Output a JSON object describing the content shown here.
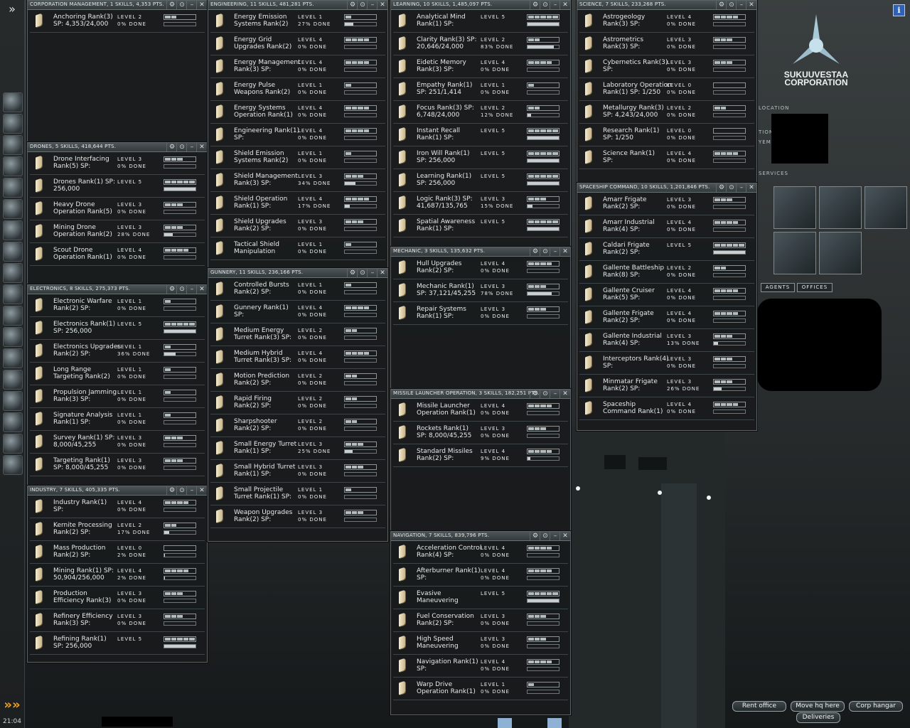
{
  "clock": "21:04",
  "neocom": {
    "expand_glyph": "»",
    "bottom_glyph": "»»",
    "icons": [
      "character-sheet-icon",
      "people-icon",
      "mail-icon",
      "notepad-icon",
      "map-icon",
      "network-icon",
      "assets-icon",
      "corporation-icon",
      "skills-icon",
      "wallet-icon",
      "help-icon",
      "channels-icon",
      "market-icon",
      "journal-icon",
      "audio-icon",
      "info-icon",
      "fitting-icon",
      "ship-icon"
    ]
  },
  "windows": [
    {
      "title": "CORPORATION MANAGEMENT, 1 SKILLS, 4,353 PTS.",
      "skills": [
        {
          "name": "Anchoring Rank(3)",
          "sp": "SP: 4,353/24,000",
          "level": "LEVEL 2",
          "done": "0% DONE",
          "lvl": 2,
          "pct": 0
        }
      ]
    },
    {
      "title": "DRONES, 5 SKILLS, 418,644 PTS.",
      "skills": [
        {
          "name": "Drone Interfacing",
          "sp": "Rank(5) SP:",
          "level": "LEVEL 3",
          "done": "0% DONE",
          "lvl": 3,
          "pct": 0
        },
        {
          "name": "Drones Rank(1) SP:",
          "sp": "256,000",
          "level": "LEVEL 5",
          "done": "",
          "lvl": 5,
          "pct": 100
        },
        {
          "name": "Heavy Drone",
          "sp": "Operation Rank(5)",
          "level": "LEVEL 3",
          "done": "0% DONE",
          "lvl": 3,
          "pct": 0
        },
        {
          "name": "Mining Drone",
          "sp": "Operation Rank(2)",
          "level": "LEVEL 3",
          "done": "28% DONE",
          "lvl": 3,
          "pct": 28
        },
        {
          "name": "Scout Drone",
          "sp": "Operation Rank(1)",
          "level": "LEVEL 4",
          "done": "0% DONE",
          "lvl": 4,
          "pct": 0
        }
      ]
    },
    {
      "title": "ELECTRONICS, 8 SKILLS, 275,373 PTS.",
      "skills": [
        {
          "name": "Electronic Warfare",
          "sp": "Rank(2) SP:",
          "level": "LEVEL 1",
          "done": "0% DONE",
          "lvl": 1,
          "pct": 0
        },
        {
          "name": "Electronics Rank(1)",
          "sp": "SP: 256,000",
          "level": "LEVEL 5",
          "done": "",
          "lvl": 5,
          "pct": 100
        },
        {
          "name": "Electronics Upgrades",
          "sp": "Rank(2) SP:",
          "level": "LEVEL 1",
          "done": "36% DONE",
          "lvl": 1,
          "pct": 36
        },
        {
          "name": "Long Range",
          "sp": "Targeting Rank(2)",
          "level": "LEVEL 1",
          "done": "0% DONE",
          "lvl": 1,
          "pct": 0
        },
        {
          "name": "Propulsion Jamming",
          "sp": "Rank(3) SP:",
          "level": "LEVEL 1",
          "done": "0% DONE",
          "lvl": 1,
          "pct": 0
        },
        {
          "name": "Signature Analysis",
          "sp": "Rank(1) SP:",
          "level": "LEVEL 1",
          "done": "0% DONE",
          "lvl": 1,
          "pct": 0
        },
        {
          "name": "Survey Rank(1) SP:",
          "sp": "8,000/45,255",
          "level": "LEVEL 3",
          "done": "0% DONE",
          "lvl": 3,
          "pct": 0
        },
        {
          "name": "Targeting Rank(1)",
          "sp": "SP: 8,000/45,255",
          "level": "LEVEL 3",
          "done": "0% DONE",
          "lvl": 3,
          "pct": 0
        }
      ]
    },
    {
      "title": "INDUSTRY, 7 SKILLS, 405,335 PTS.",
      "skills": [
        {
          "name": "Industry Rank(1)",
          "sp": "SP:",
          "level": "LEVEL 4",
          "done": "0% DONE",
          "lvl": 4,
          "pct": 0
        },
        {
          "name": "Kernite Processing",
          "sp": "Rank(2) SP:",
          "level": "LEVEL 2",
          "done": "17% DONE",
          "lvl": 2,
          "pct": 17
        },
        {
          "name": "Mass Production",
          "sp": "Rank(2) SP:",
          "level": "LEVEL 0",
          "done": "2% DONE",
          "lvl": 0,
          "pct": 2
        },
        {
          "name": "Mining Rank(1) SP:",
          "sp": "50,904/256,000",
          "level": "LEVEL 4",
          "done": "2% DONE",
          "lvl": 4,
          "pct": 2
        },
        {
          "name": "Production",
          "sp": "Efficiency Rank(3)",
          "level": "LEVEL 3",
          "done": "0% DONE",
          "lvl": 3,
          "pct": 0
        },
        {
          "name": "Refinery Efficiency",
          "sp": "Rank(3) SP:",
          "level": "LEVEL 3",
          "done": "0% DONE",
          "lvl": 3,
          "pct": 0
        },
        {
          "name": "Refining Rank(1)",
          "sp": "SP: 256,000",
          "level": "LEVEL 5",
          "done": "",
          "lvl": 5,
          "pct": 100
        }
      ]
    },
    {
      "title": "ENGINEERING, 11 SKILLS, 481,281 PTS.",
      "skills": [
        {
          "name": "Energy Emission",
          "sp": "Systems Rank(2)",
          "level": "LEVEL 1",
          "done": "27% DONE",
          "lvl": 1,
          "pct": 27
        },
        {
          "name": "Energy Grid",
          "sp": "Upgrades Rank(2)",
          "level": "LEVEL 4",
          "done": "0% DONE",
          "lvl": 4,
          "pct": 0
        },
        {
          "name": "Energy Management",
          "sp": "Rank(3) SP:",
          "level": "LEVEL 4",
          "done": "0% DONE",
          "lvl": 4,
          "pct": 0
        },
        {
          "name": "Energy Pulse",
          "sp": "Weapons Rank(2)",
          "level": "LEVEL 1",
          "done": "0% DONE",
          "lvl": 1,
          "pct": 0
        },
        {
          "name": "Energy Systems",
          "sp": "Operation Rank(1)",
          "level": "LEVEL 4",
          "done": "0% DONE",
          "lvl": 4,
          "pct": 0
        },
        {
          "name": "Engineering Rank(1)",
          "sp": "SP:",
          "level": "LEVEL 4",
          "done": "0% DONE",
          "lvl": 4,
          "pct": 0
        },
        {
          "name": "Shield Emission",
          "sp": "Systems Rank(2)",
          "level": "LEVEL 1",
          "done": "0% DONE",
          "lvl": 1,
          "pct": 0
        },
        {
          "name": "Shield Management",
          "sp": "Rank(3) SP:",
          "level": "LEVEL 3",
          "done": "34% DONE",
          "lvl": 3,
          "pct": 34
        },
        {
          "name": "Shield Operation",
          "sp": "Rank(1) SP:",
          "level": "LEVEL 4",
          "done": "17% DONE",
          "lvl": 4,
          "pct": 17
        },
        {
          "name": "Shield Upgrades",
          "sp": "Rank(2) SP:",
          "level": "LEVEL 3",
          "done": "0% DONE",
          "lvl": 3,
          "pct": 0
        },
        {
          "name": "Tactical Shield",
          "sp": "Manipulation",
          "level": "LEVEL 1",
          "done": "0% DONE",
          "lvl": 1,
          "pct": 0
        }
      ]
    },
    {
      "title": "GUNNERY, 11 SKILLS, 236,166 PTS.",
      "skills": [
        {
          "name": "Controlled Bursts",
          "sp": "Rank(2) SP:",
          "level": "LEVEL 1",
          "done": "0% DONE",
          "lvl": 1,
          "pct": 0
        },
        {
          "name": "Gunnery Rank(1)",
          "sp": "SP:",
          "level": "LEVEL 4",
          "done": "0% DONE",
          "lvl": 4,
          "pct": 0
        },
        {
          "name": "Medium Energy",
          "sp": "Turret Rank(3) SP:",
          "level": "LEVEL 2",
          "done": "0% DONE",
          "lvl": 2,
          "pct": 0
        },
        {
          "name": "Medium Hybrid",
          "sp": "Turret Rank(3) SP:",
          "level": "LEVEL 4",
          "done": "0% DONE",
          "lvl": 4,
          "pct": 0
        },
        {
          "name": "Motion Prediction",
          "sp": "Rank(2) SP:",
          "level": "LEVEL 2",
          "done": "0% DONE",
          "lvl": 2,
          "pct": 0
        },
        {
          "name": "Rapid Firing",
          "sp": "Rank(2) SP:",
          "level": "LEVEL 2",
          "done": "0% DONE",
          "lvl": 2,
          "pct": 0
        },
        {
          "name": "Sharpshooter",
          "sp": "Rank(2) SP:",
          "level": "LEVEL 2",
          "done": "0% DONE",
          "lvl": 2,
          "pct": 0
        },
        {
          "name": "Small Energy Turret",
          "sp": "Rank(1) SP:",
          "level": "LEVEL 3",
          "done": "25% DONE",
          "lvl": 3,
          "pct": 25
        },
        {
          "name": "Small Hybrid Turret",
          "sp": "Rank(1) SP:",
          "level": "LEVEL 3",
          "done": "0% DONE",
          "lvl": 3,
          "pct": 0
        },
        {
          "name": "Small Projectile",
          "sp": "Turret Rank(1) SP:",
          "level": "LEVEL 1",
          "done": "0% DONE",
          "lvl": 1,
          "pct": 0
        },
        {
          "name": "Weapon Upgrades",
          "sp": "Rank(2) SP:",
          "level": "LEVEL 3",
          "done": "0% DONE",
          "lvl": 3,
          "pct": 0
        }
      ]
    },
    {
      "title": "LEARNING, 10 SKILLS, 1,485,097 PTS.",
      "skills": [
        {
          "name": "Analytical Mind",
          "sp": "Rank(1) SP:",
          "level": "LEVEL 5",
          "done": "",
          "lvl": 5,
          "pct": 100
        },
        {
          "name": "Clarity Rank(3) SP:",
          "sp": "20,646/24,000",
          "level": "LEVEL 2",
          "done": "83% DONE",
          "lvl": 2,
          "pct": 83
        },
        {
          "name": "Eidetic Memory",
          "sp": "Rank(3) SP:",
          "level": "LEVEL 4",
          "done": "0% DONE",
          "lvl": 4,
          "pct": 0
        },
        {
          "name": "Empathy Rank(1)",
          "sp": "SP: 251/1,414",
          "level": "LEVEL 1",
          "done": "0% DONE",
          "lvl": 1,
          "pct": 0
        },
        {
          "name": "Focus Rank(3) SP:",
          "sp": "6,748/24,000",
          "level": "LEVEL 2",
          "done": "12% DONE",
          "lvl": 2,
          "pct": 12
        },
        {
          "name": "Instant Recall",
          "sp": "Rank(1) SP:",
          "level": "LEVEL 5",
          "done": "",
          "lvl": 5,
          "pct": 100
        },
        {
          "name": "Iron Will Rank(1)",
          "sp": "SP: 256,000",
          "level": "LEVEL 5",
          "done": "",
          "lvl": 5,
          "pct": 100
        },
        {
          "name": "Learning Rank(1)",
          "sp": "SP: 256,000",
          "level": "LEVEL 5",
          "done": "",
          "lvl": 5,
          "pct": 100
        },
        {
          "name": "Logic Rank(3) SP:",
          "sp": "41,687/135,765",
          "level": "LEVEL 3",
          "done": "15% DONE",
          "lvl": 3,
          "pct": 15
        },
        {
          "name": "Spatial Awareness",
          "sp": "Rank(1) SP:",
          "level": "LEVEL 5",
          "done": "",
          "lvl": 5,
          "pct": 100
        }
      ]
    },
    {
      "title": "MECHANIC, 3 SKILLS, 135,632 PTS.",
      "skills": [
        {
          "name": "Hull Upgrades",
          "sp": "Rank(2) SP:",
          "level": "LEVEL 4",
          "done": "0% DONE",
          "lvl": 4,
          "pct": 0
        },
        {
          "name": "Mechanic Rank(1)",
          "sp": "SP: 37,121/45,255",
          "level": "LEVEL 3",
          "done": "78% DONE",
          "lvl": 3,
          "pct": 78
        },
        {
          "name": "Repair Systems",
          "sp": "Rank(1) SP:",
          "level": "LEVEL 3",
          "done": "0% DONE",
          "lvl": 3,
          "pct": 0
        }
      ]
    },
    {
      "title": "MISSILE LAUNCHER OPERATION, 3 SKILLS, 182,251 PTS.",
      "skills": [
        {
          "name": "Missile Launcher",
          "sp": "Operation Rank(1)",
          "level": "LEVEL 4",
          "done": "0% DONE",
          "lvl": 4,
          "pct": 0
        },
        {
          "name": "Rockets Rank(1)",
          "sp": "SP: 8,000/45,255",
          "level": "LEVEL 3",
          "done": "0% DONE",
          "lvl": 3,
          "pct": 0
        },
        {
          "name": "Standard Missiles",
          "sp": "Rank(2) SP:",
          "level": "LEVEL 4",
          "done": "9% DONE",
          "lvl": 4,
          "pct": 9
        }
      ]
    },
    {
      "title": "NAVIGATION, 7 SKILLS, 839,796 PTS.",
      "skills": [
        {
          "name": "Acceleration Control",
          "sp": "Rank(4) SP:",
          "level": "LEVEL 4",
          "done": "0% DONE",
          "lvl": 4,
          "pct": 0
        },
        {
          "name": "Afterburner Rank(1)",
          "sp": "SP:",
          "level": "LEVEL 4",
          "done": "0% DONE",
          "lvl": 4,
          "pct": 0
        },
        {
          "name": "Evasive",
          "sp": "Maneuvering",
          "level": "LEVEL 5",
          "done": "",
          "lvl": 5,
          "pct": 100
        },
        {
          "name": "Fuel Conservation",
          "sp": "Rank(2) SP:",
          "level": "LEVEL 3",
          "done": "0% DONE",
          "lvl": 3,
          "pct": 0
        },
        {
          "name": "High Speed",
          "sp": "Maneuvering",
          "level": "LEVEL 3",
          "done": "0% DONE",
          "lvl": 3,
          "pct": 0
        },
        {
          "name": "Navigation Rank(1)",
          "sp": "SP:",
          "level": "LEVEL 4",
          "done": "0% DONE",
          "lvl": 4,
          "pct": 0
        },
        {
          "name": "Warp Drive",
          "sp": "Operation Rank(1)",
          "level": "LEVEL 1",
          "done": "0% DONE",
          "lvl": 1,
          "pct": 0
        }
      ]
    },
    {
      "title": "SCIENCE, 7 SKILLS, 233,268 PTS.",
      "skills": [
        {
          "name": "Astrogeology",
          "sp": "Rank(3) SP:",
          "level": "LEVEL 4",
          "done": "0% DONE",
          "lvl": 4,
          "pct": 0
        },
        {
          "name": "Astrometrics",
          "sp": "Rank(3) SP:",
          "level": "LEVEL 3",
          "done": "0% DONE",
          "lvl": 3,
          "pct": 0
        },
        {
          "name": "Cybernetics Rank(3)",
          "sp": "SP:",
          "level": "LEVEL 3",
          "done": "0% DONE",
          "lvl": 3,
          "pct": 0
        },
        {
          "name": "Laboratory Operation",
          "sp": "Rank(1) SP: 1/250",
          "level": "LEVEL 0",
          "done": "0% DONE",
          "lvl": 0,
          "pct": 0
        },
        {
          "name": "Metallurgy Rank(3)",
          "sp": "SP: 4,243/24,000",
          "level": "LEVEL 2",
          "done": "0% DONE",
          "lvl": 2,
          "pct": 0
        },
        {
          "name": "Research Rank(1)",
          "sp": "SP: 1/250",
          "level": "LEVEL 0",
          "done": "0% DONE",
          "lvl": 0,
          "pct": 0
        },
        {
          "name": "Science Rank(1)",
          "sp": "SP:",
          "level": "LEVEL 4",
          "done": "0% DONE",
          "lvl": 4,
          "pct": 0
        }
      ]
    },
    {
      "title": "SPACESHIP COMMAND, 10 SKILLS, 1,201,846 PTS.",
      "skills": [
        {
          "name": "Amarr Frigate",
          "sp": "Rank(2) SP:",
          "level": "LEVEL 3",
          "done": "0% DONE",
          "lvl": 3,
          "pct": 0
        },
        {
          "name": "Amarr Industrial",
          "sp": "Rank(4) SP:",
          "level": "LEVEL 4",
          "done": "0% DONE",
          "lvl": 4,
          "pct": 0
        },
        {
          "name": "Caldari Frigate",
          "sp": "Rank(2) SP:",
          "level": "LEVEL 5",
          "done": "",
          "lvl": 5,
          "pct": 100
        },
        {
          "name": "Gallente Battleship",
          "sp": "Rank(8) SP:",
          "level": "LEVEL 2",
          "done": "0% DONE",
          "lvl": 2,
          "pct": 0
        },
        {
          "name": "Gallente Cruiser",
          "sp": "Rank(5) SP:",
          "level": "LEVEL 4",
          "done": "0% DONE",
          "lvl": 4,
          "pct": 0
        },
        {
          "name": "Gallente Frigate",
          "sp": "Rank(2) SP:",
          "level": "LEVEL 4",
          "done": "0% DONE",
          "lvl": 4,
          "pct": 0
        },
        {
          "name": "Gallente Industrial",
          "sp": "Rank(4) SP:",
          "level": "LEVEL 3",
          "done": "13% DONE",
          "lvl": 3,
          "pct": 13
        },
        {
          "name": "Interceptors Rank(4)",
          "sp": "SP:",
          "level": "LEVEL 3",
          "done": "0% DONE",
          "lvl": 3,
          "pct": 0
        },
        {
          "name": "Minmatar Frigate",
          "sp": "Rank(2) SP:",
          "level": "LEVEL 3",
          "done": "26% DONE",
          "lvl": 3,
          "pct": 26
        },
        {
          "name": "Spaceship",
          "sp": "Command Rank(1)",
          "level": "LEVEL 4",
          "done": "0% DONE",
          "lvl": 4,
          "pct": 0
        }
      ]
    }
  ],
  "station": {
    "corp_line1": "SUKUUVESTAA",
    "corp_line2": "CORPORATION",
    "location_label": "LOCATION",
    "loc_frag1": "TION",
    "loc_frag2": "YEM",
    "services_label": "SERVICES",
    "tabs": [
      "AGENTS",
      "OFFICES"
    ],
    "buttons": {
      "rent": "Rent office",
      "move": "Move hq here",
      "hangar": "Corp hangar",
      "deliveries": "Deliveries"
    },
    "info_glyph": "i"
  },
  "window_controls": {
    "settings": "⚙",
    "pin": "⊙",
    "min": "–",
    "close": "✕"
  }
}
